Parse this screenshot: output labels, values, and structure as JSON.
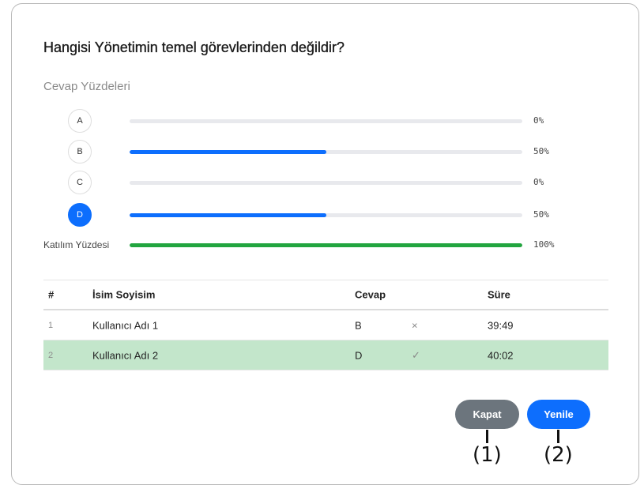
{
  "question": "Hangisi Yönetimin temel görevlerinden değildir?",
  "section_title": "Cevap Yüzdeleri",
  "options": [
    {
      "letter": "A",
      "percent_text": "0%",
      "percent": 0,
      "selected": false
    },
    {
      "letter": "B",
      "percent_text": "50%",
      "percent": 50,
      "selected": false
    },
    {
      "letter": "C",
      "percent_text": "0%",
      "percent": 0,
      "selected": false
    },
    {
      "letter": "D",
      "percent_text": "50%",
      "percent": 50,
      "selected": true
    }
  ],
  "participation": {
    "label": "Katılım Yüzdesi",
    "percent_text": "100%",
    "percent": 100
  },
  "table": {
    "headers": {
      "num": "#",
      "name": "İsim Soyisim",
      "answer": "Cevap",
      "time": "Süre"
    },
    "rows": [
      {
        "num": "1",
        "name": "Kullanıcı Adı 1",
        "answer": "B",
        "mark": "×",
        "mark_icon": "cross-icon",
        "time": "39:49",
        "correct": false
      },
      {
        "num": "2",
        "name": "Kullanıcı Adı 2",
        "answer": "D",
        "mark": "✓",
        "mark_icon": "check-icon",
        "time": "40:02",
        "correct": true
      }
    ]
  },
  "buttons": {
    "close": "Kapat",
    "refresh": "Yenile"
  },
  "callouts": {
    "close": "(1)",
    "refresh": "(2)"
  },
  "colors": {
    "primary": "#0d6efd",
    "secondary": "#6c757d",
    "success": "#22a53f",
    "correct_row": "#c3e6cb"
  }
}
